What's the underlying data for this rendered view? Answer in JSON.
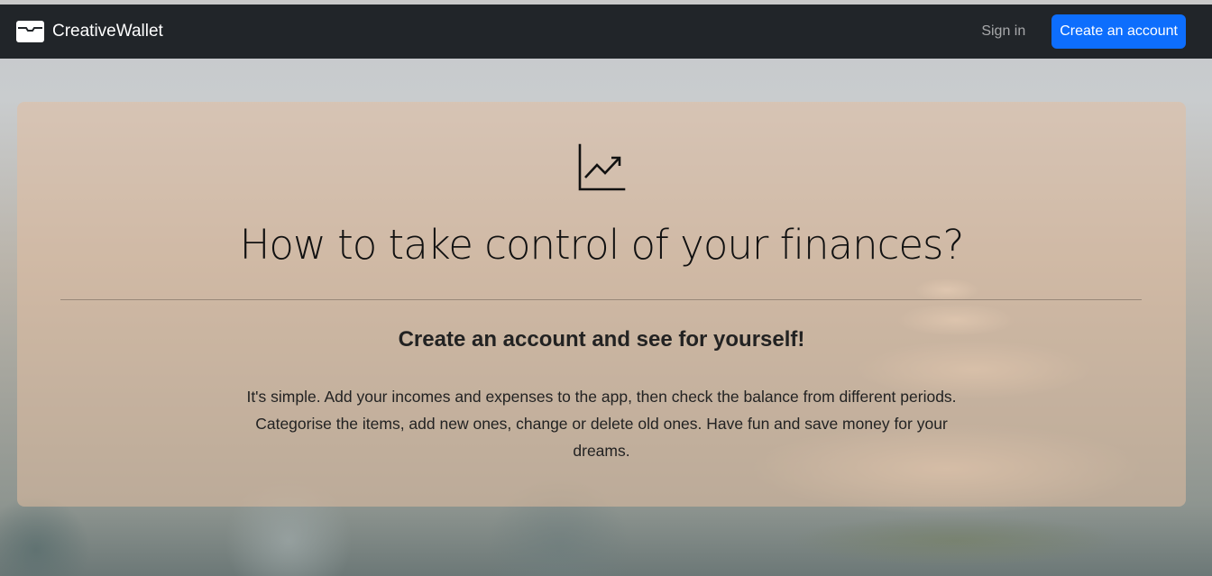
{
  "navbar": {
    "brand": "CreativeWallet",
    "brand_icon": "wallet-icon",
    "signin_label": "Sign in",
    "create_account_label": "Create an account"
  },
  "hero": {
    "icon": "graph-up-arrow-icon",
    "headline": "How to take control of your finances?",
    "subheadline": "Create an account and see for yourself!",
    "description": "It's simple. Add your incomes and expenses to the app, then check the balance from different periods. Categorise the items, add new ones, change or delete old ones. Have fun and save money for your dreams."
  },
  "colors": {
    "navbar_bg": "#212529",
    "primary_button": "#0d6efd"
  }
}
